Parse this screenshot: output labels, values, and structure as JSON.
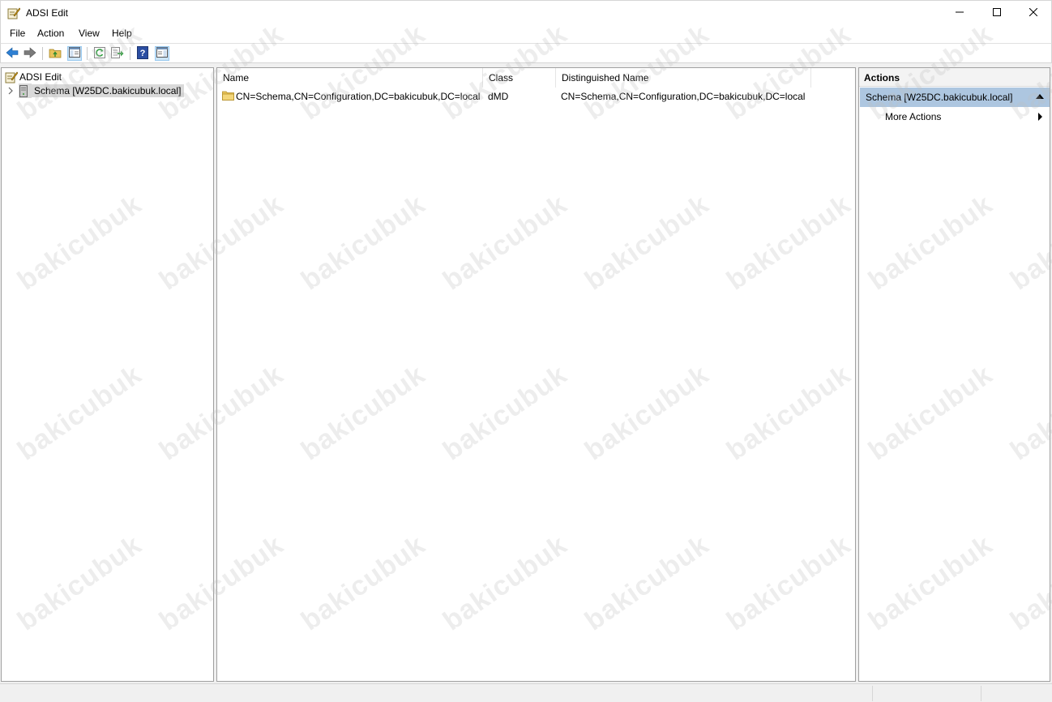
{
  "window": {
    "title": "ADSI Edit",
    "app_icon": "adsi-edit-icon",
    "controls": [
      "minimize-icon",
      "maximize-icon",
      "close-icon"
    ]
  },
  "menu": {
    "items": [
      {
        "label": "File"
      },
      {
        "label": "Action"
      },
      {
        "label": "View"
      },
      {
        "label": "Help"
      }
    ]
  },
  "toolbar": {
    "buttons": [
      {
        "icon": "back-arrow-icon",
        "color": "#2d7fd3"
      },
      {
        "icon": "forward-arrow-icon",
        "color": "#6b6b6b"
      },
      {
        "icon": "up-folder-icon"
      },
      {
        "icon": "show-hide-console-tree-icon",
        "active": true
      },
      {
        "icon": "refresh-icon"
      },
      {
        "icon": "export-list-icon"
      },
      {
        "icon": "help-icon"
      },
      {
        "icon": "show-hide-action-pane-icon",
        "active": true
      }
    ]
  },
  "tree": {
    "root_label": "ADSI Edit",
    "items": [
      {
        "label": "Schema [W25DC.bakicubuk.local]",
        "selected": true,
        "icon": "server-icon"
      }
    ]
  },
  "list": {
    "columns": [
      {
        "label": "Name"
      },
      {
        "label": "Class"
      },
      {
        "label": "Distinguished Name"
      }
    ],
    "rows": [
      {
        "name": "CN=Schema,CN=Configuration,DC=bakicubuk,DC=local",
        "class": "dMD",
        "dn": "CN=Schema,CN=Configuration,DC=bakicubuk,DC=local",
        "icon": "folder-icon"
      }
    ]
  },
  "actions": {
    "title": "Actions",
    "group_label": "Schema [W25DC.bakicubuk.local]",
    "items": [
      {
        "label": "More Actions"
      }
    ]
  },
  "watermark": {
    "text": "bakicubuk"
  },
  "colors": {
    "selection_gray": "#d9d9d9",
    "actions_group_bg": "#adc6e0",
    "folder_yellow": "#e8c25a"
  }
}
